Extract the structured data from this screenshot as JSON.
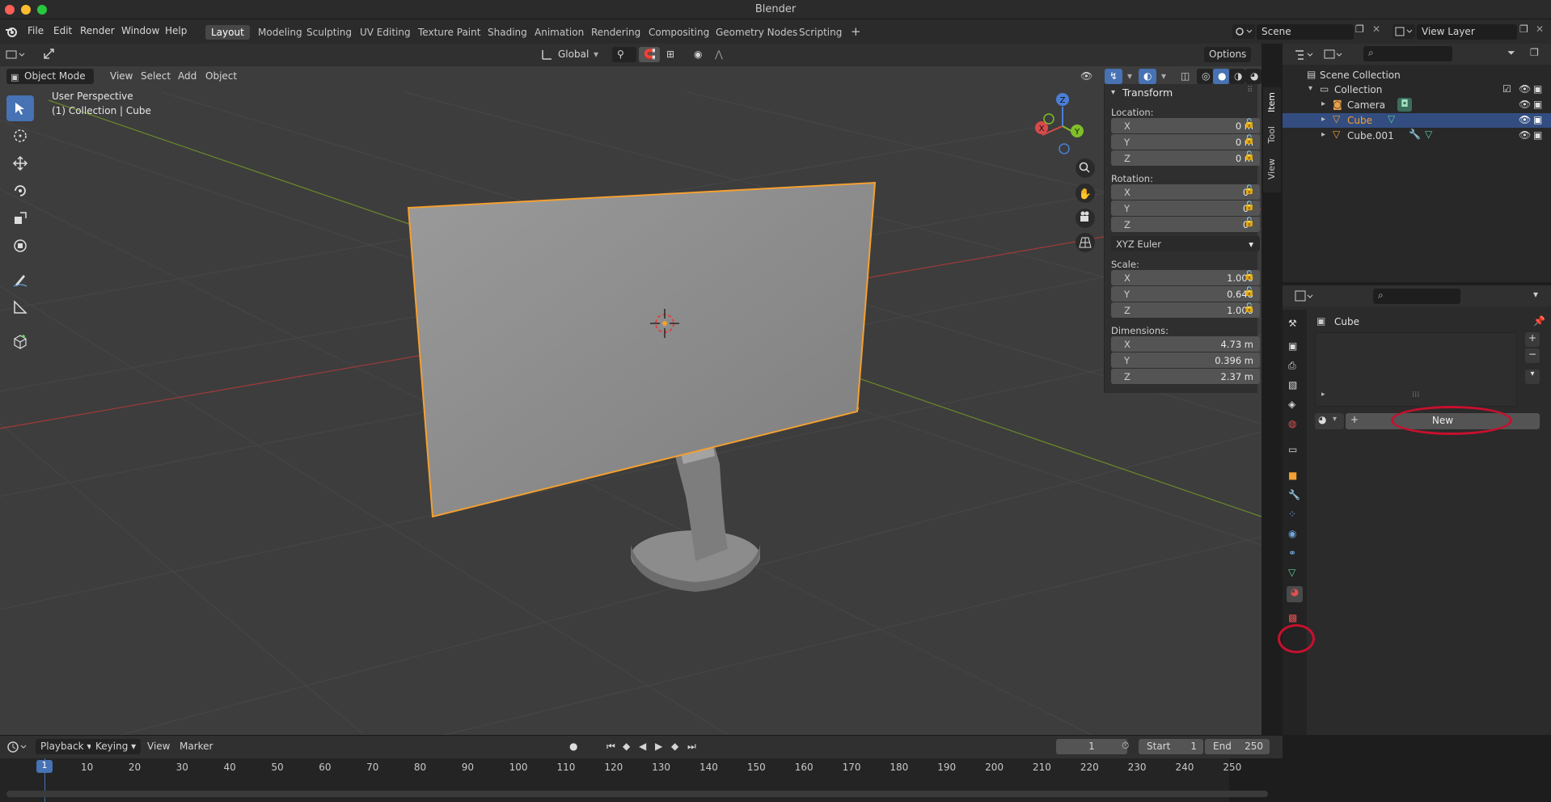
{
  "window": {
    "title": "Blender"
  },
  "menu": [
    "File",
    "Edit",
    "Render",
    "Window",
    "Help"
  ],
  "workspaces": [
    "Layout",
    "Modeling",
    "Sculpting",
    "UV Editing",
    "Texture Paint",
    "Shading",
    "Animation",
    "Rendering",
    "Compositing",
    "Geometry Nodes",
    "Scripting"
  ],
  "active_workspace": "Layout",
  "scene": {
    "name": "Scene",
    "view_layer": "View Layer"
  },
  "viewport": {
    "orientation": "Global",
    "options_label": "Options",
    "mode": "Object Mode",
    "header_menus": [
      "View",
      "Select",
      "Add",
      "Object"
    ],
    "perspective_label": "User Perspective",
    "collection_label": "(1) Collection | Cube",
    "gizmo_axes": [
      "X",
      "Y",
      "Z"
    ]
  },
  "n_panel": {
    "section": "Transform",
    "tabs": [
      "Item",
      "Tool",
      "View"
    ],
    "location_label": "Location:",
    "location": [
      {
        "axis": "X",
        "value": "0 m"
      },
      {
        "axis": "Y",
        "value": "0 m"
      },
      {
        "axis": "Z",
        "value": "0 m"
      }
    ],
    "rotation_label": "Rotation:",
    "rotation": [
      {
        "axis": "X",
        "value": "0°"
      },
      {
        "axis": "Y",
        "value": "0°"
      },
      {
        "axis": "Z",
        "value": "0°"
      }
    ],
    "rotation_mode": "XYZ Euler",
    "scale_label": "Scale:",
    "scale": [
      {
        "axis": "X",
        "value": "1.000"
      },
      {
        "axis": "Y",
        "value": "0.648"
      },
      {
        "axis": "Z",
        "value": "1.000"
      }
    ],
    "dimensions_label": "Dimensions:",
    "dimensions": [
      {
        "axis": "X",
        "value": "4.73 m"
      },
      {
        "axis": "Y",
        "value": "0.396 m"
      },
      {
        "axis": "Z",
        "value": "2.37 m"
      }
    ]
  },
  "outliner": {
    "rows": [
      "Scene Collection",
      "Collection",
      "Camera",
      "Cube",
      "Cube.001"
    ],
    "selected": "Cube"
  },
  "properties": {
    "object_name": "Cube",
    "new_button": "New",
    "active_tab": "material"
  },
  "timeline": {
    "menus": [
      "Playback",
      "Keying",
      "View",
      "Marker"
    ],
    "current_frame": "1",
    "start_label": "Start",
    "start": "1",
    "end_label": "End",
    "end": "250",
    "ticks": [
      "1",
      "10",
      "20",
      "30",
      "40",
      "50",
      "60",
      "70",
      "80",
      "90",
      "100",
      "110",
      "120",
      "130",
      "140",
      "150",
      "160",
      "170",
      "180",
      "190",
      "200",
      "210",
      "220",
      "230",
      "240",
      "250"
    ]
  },
  "colors": {
    "accent": "#4772b3",
    "selection_outline": "#f5a030",
    "highlight_circle": "#c8102e"
  }
}
